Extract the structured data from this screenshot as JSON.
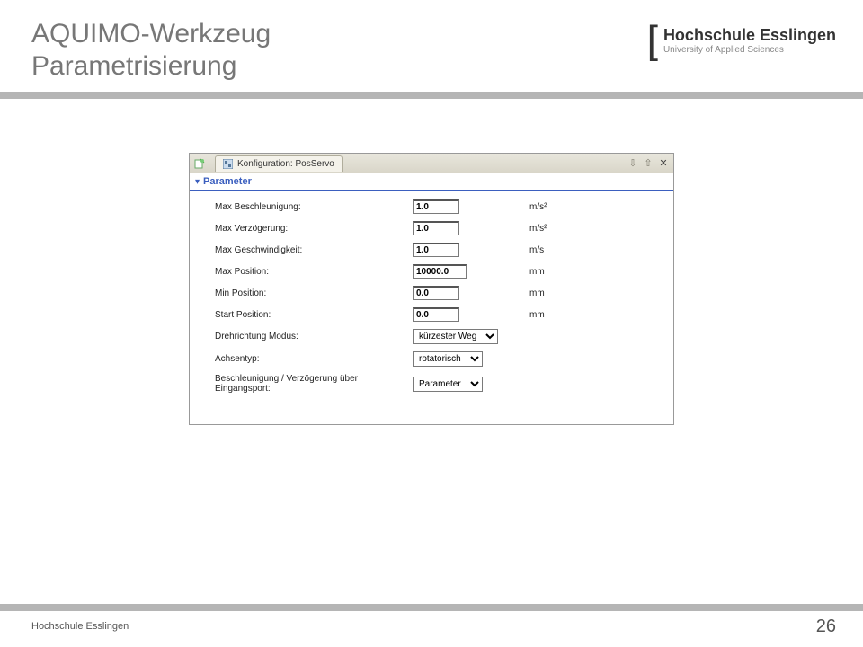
{
  "slide": {
    "title_line1": "AQUIMO-Werkzeug",
    "title_line2": "Parametrisierung",
    "footer_text": "Hochschule Esslingen",
    "page_number": "26"
  },
  "logo": {
    "main": "Hochschule Esslingen",
    "sub": "University of Applied Sciences"
  },
  "window": {
    "tab_label": "Konfiguration: PosServo",
    "section_title": "Parameter"
  },
  "params": [
    {
      "label": "Max Beschleunigung:",
      "type": "input",
      "value": "1.0",
      "unit": "m/s²",
      "wide": false
    },
    {
      "label": "Max Verzögerung:",
      "type": "input",
      "value": "1.0",
      "unit": "m/s²",
      "wide": false
    },
    {
      "label": "Max Geschwindigkeit:",
      "type": "input",
      "value": "1.0",
      "unit": "m/s",
      "wide": false
    },
    {
      "label": "Max Position:",
      "type": "input",
      "value": "10000.0",
      "unit": "mm",
      "wide": true
    },
    {
      "label": "Min Position:",
      "type": "input",
      "value": "0.0",
      "unit": "mm",
      "wide": false
    },
    {
      "label": "Start Position:",
      "type": "input",
      "value": "0.0",
      "unit": "mm",
      "wide": false
    },
    {
      "label": "Drehrichtung Modus:",
      "type": "select",
      "value": "kürzester Weg",
      "sel_class": "sel-kw"
    },
    {
      "label": "Achsentyp:",
      "type": "select",
      "value": "rotatorisch",
      "sel_class": "sel-rot"
    },
    {
      "label": "Beschleunigung / Verzögerung über Eingangsport:",
      "type": "select",
      "value": "Parameter",
      "sel_class": "sel-par"
    }
  ]
}
